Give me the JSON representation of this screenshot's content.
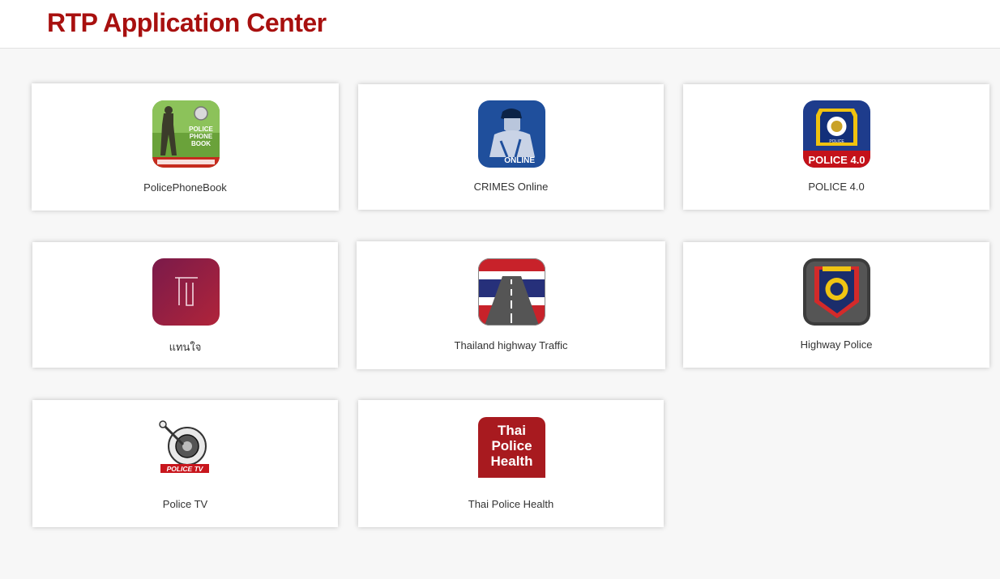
{
  "header": {
    "title": "RTP Application Center"
  },
  "apps": [
    {
      "name": "PolicePhoneBook",
      "icon": "police-phonebook-icon",
      "icon_text": [
        "POLICE",
        "PHONE",
        "BOOK"
      ]
    },
    {
      "name": "CRIMES Online",
      "icon": "crimes-online-icon",
      "icon_text": "ONLINE"
    },
    {
      "name": "POLICE 4.0",
      "icon": "police-4-icon",
      "icon_text": "POLICE 4.0"
    },
    {
      "name": "แทนใจ",
      "icon": "thaenjai-icon"
    },
    {
      "name": "Thailand highway Traffic",
      "icon": "highway-traffic-icon"
    },
    {
      "name": "Highway Police",
      "icon": "highway-police-icon"
    },
    {
      "name": "Police TV",
      "icon": "police-tv-icon",
      "icon_text": "POLICE TV"
    },
    {
      "name": "Thai Police Health",
      "icon": "thai-police-health-icon",
      "icon_text": [
        "Thai",
        "Police",
        "Health"
      ]
    }
  ],
  "colors": {
    "brand": "#a8100f",
    "background": "#f7f7f7"
  }
}
